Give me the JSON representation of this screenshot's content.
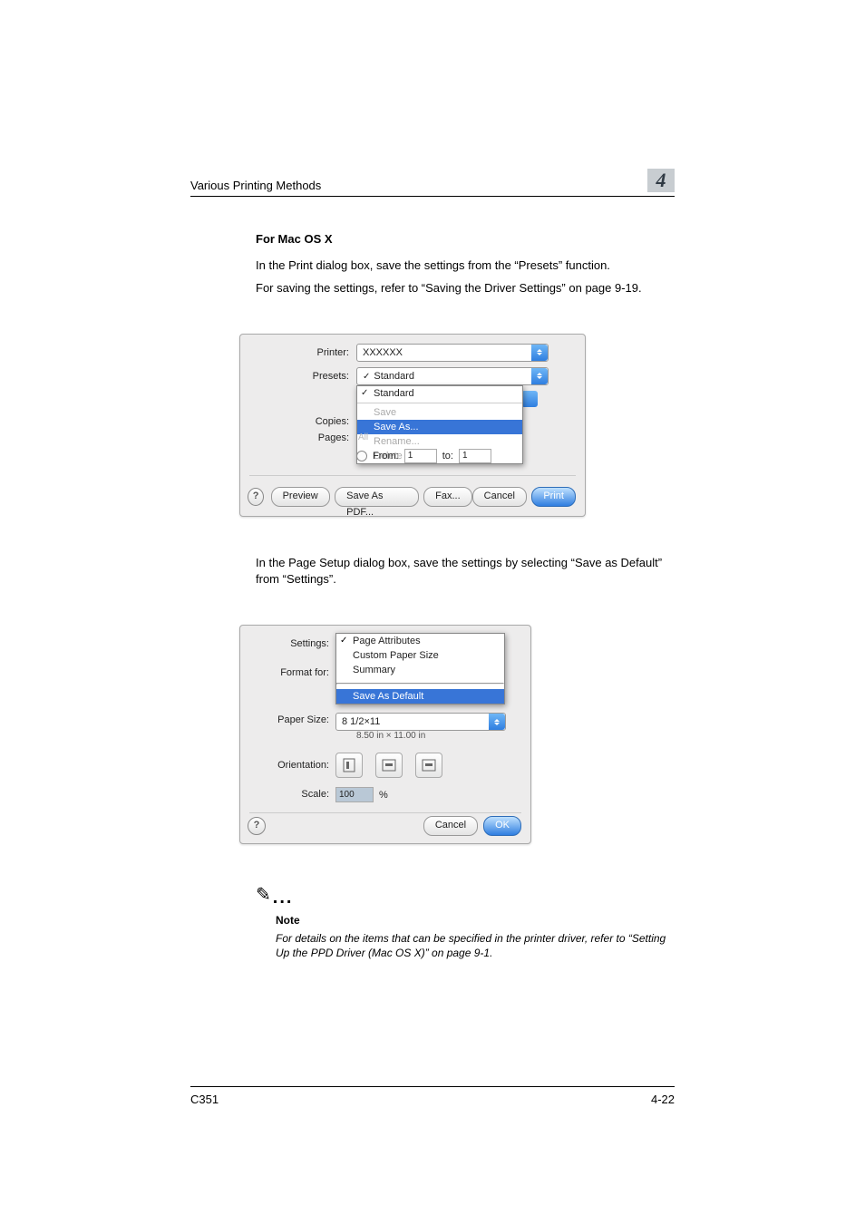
{
  "header": {
    "title": "Various Printing Methods",
    "chapter": "4"
  },
  "section": {
    "heading": "For Mac OS X",
    "para1": "In the Print dialog box, save the settings from the “Presets” function.",
    "para2": "For saving the settings, refer to “Saving the Driver Settings” on page 9-19."
  },
  "print_dialog": {
    "labels": {
      "printer": "Printer:",
      "presets": "Presets:",
      "copies": "Copies:",
      "pages": "Pages:",
      "from": "From:",
      "to": "to:"
    },
    "printer_value": "XXXXXX",
    "presets_value": "Standard",
    "menu": {
      "save": "Save",
      "save_as": "Save As...",
      "rename": "Rename...",
      "delete": "Delete"
    },
    "pages_all": "All",
    "from_value": "1",
    "to_value": "1",
    "buttons": {
      "preview": "Preview",
      "save_pdf": "Save As PDF...",
      "fax": "Fax...",
      "cancel": "Cancel",
      "print": "Print"
    },
    "help": "?"
  },
  "mid_para": "In the Page Setup dialog box, save the settings by selecting “Save as Default” from “Settings”.",
  "page_setup": {
    "labels": {
      "settings": "Settings:",
      "format_for": "Format for:",
      "paper_size": "Paper Size:",
      "orientation": "Orientation:",
      "scale": "Scale:"
    },
    "menu": {
      "page_attr": "Page Attributes",
      "custom": "Custom Paper Size",
      "summary": "Summary",
      "save_default": "Save As Default"
    },
    "paper_size_value": "8 1/2×11",
    "paper_dim": "8.50 in × 11.00 in",
    "scale_value": "100",
    "scale_pct": "%",
    "buttons": {
      "cancel": "Cancel",
      "ok": "OK"
    },
    "help": "?"
  },
  "note": {
    "label": "Note",
    "text": "For details on the items that can be specified in the printer driver, refer to “Setting Up the PPD Driver (Mac OS X)” on page 9-1."
  },
  "footer": {
    "left": "C351",
    "right": "4-22"
  }
}
